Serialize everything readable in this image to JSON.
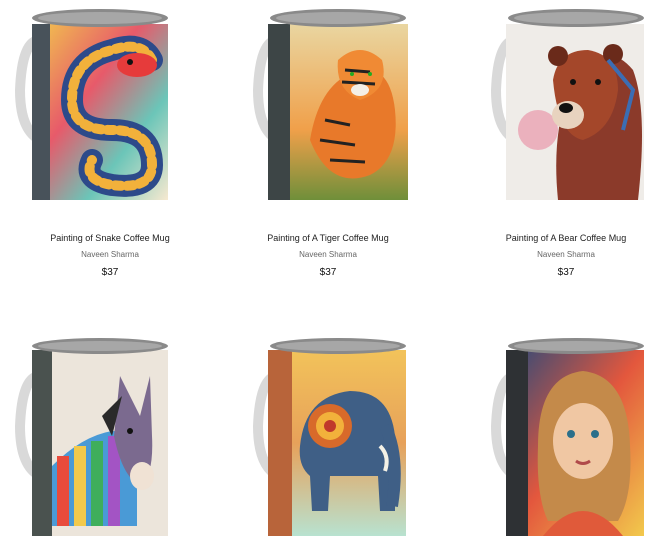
{
  "products": [
    {
      "title": "Painting of Snake Coffee Mug",
      "artist": "Naveen Sharma",
      "price": "$37",
      "image": "snake"
    },
    {
      "title": "Painting of A Tiger Coffee Mug",
      "artist": "Naveen Sharma",
      "price": "$37",
      "image": "tiger"
    },
    {
      "title": "Painting of A Bear Coffee Mug",
      "artist": "Naveen Sharma",
      "price": "$37",
      "image": "bear"
    },
    {
      "title": "",
      "artist": "",
      "price": "",
      "image": "donkey"
    },
    {
      "title": "",
      "artist": "",
      "price": "",
      "image": "elephant"
    },
    {
      "title": "",
      "artist": "",
      "price": "",
      "image": "girl"
    }
  ]
}
